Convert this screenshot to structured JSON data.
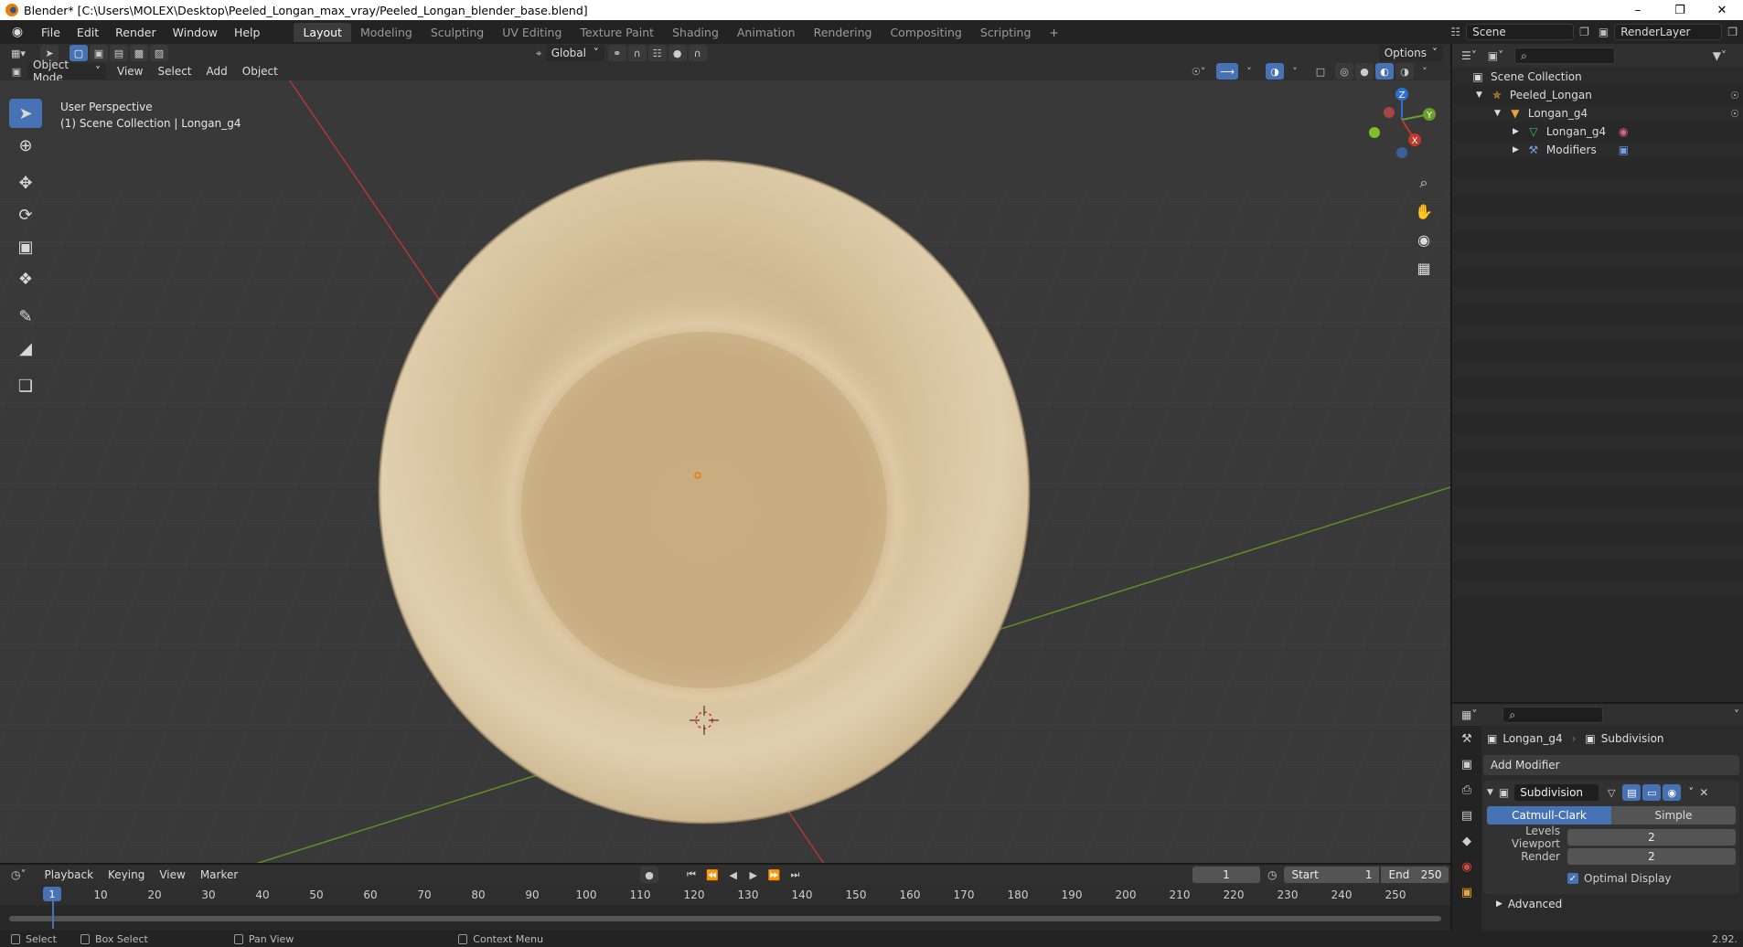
{
  "window": {
    "title": "Blender* [C:\\Users\\MOLEX\\Desktop\\Peeled_Longan_max_vray/Peeled_Longan_blender_base.blend]",
    "minimize": "–",
    "restore": "❐",
    "close": "✕"
  },
  "menu": [
    "File",
    "Edit",
    "Render",
    "Window",
    "Help"
  ],
  "workspaces": {
    "active": "Layout",
    "others": [
      "Modeling",
      "Sculpting",
      "UV Editing",
      "Texture Paint",
      "Shading",
      "Animation",
      "Rendering",
      "Compositing",
      "Scripting"
    ],
    "add": "+"
  },
  "scene": {
    "name": "Scene",
    "render_layer": "RenderLayer"
  },
  "viewport_header": {
    "mode": "Object Mode",
    "menus": [
      "View",
      "Select",
      "Add",
      "Object"
    ],
    "transform_orientation": "Global",
    "options": "Options"
  },
  "viewport": {
    "perspective": "User Perspective",
    "collection_info": "(1) Scene Collection | Longan_g4",
    "gizmo": {
      "z": "Z",
      "y": "Y",
      "x": "X"
    },
    "object_color": "#d8c7a3"
  },
  "outliner": {
    "root": "Scene Collection",
    "items": [
      {
        "label": "Peeled_Longan"
      },
      {
        "label": "Longan_g4"
      },
      {
        "label": "Longan_g4"
      },
      {
        "label": "Modifiers"
      }
    ]
  },
  "properties": {
    "object": "Longan_g4",
    "modifier": "Subdivision",
    "add_modifier": "Add Modifier",
    "modifier_name": "Subdivision",
    "methods": [
      "Catmull-Clark",
      "Simple"
    ],
    "levels_viewport_label": "Levels Viewport",
    "levels_viewport": "2",
    "render_label": "Render",
    "render": "2",
    "optimal_display": "Optimal Display",
    "advanced": "Advanced"
  },
  "timeline": {
    "menus": [
      "Playback",
      "Keying",
      "View",
      "Marker"
    ],
    "current_frame": "1",
    "start_label": "Start",
    "start": "1",
    "end_label": "End",
    "end": "250",
    "ruler": [
      "10",
      "20",
      "30",
      "40",
      "50",
      "60",
      "70",
      "80",
      "90",
      "100",
      "110",
      "120",
      "130",
      "140",
      "150",
      "160",
      "170",
      "180",
      "190",
      "200",
      "210",
      "220",
      "230",
      "240",
      "250"
    ],
    "playhead": "1"
  },
  "statusbar": {
    "select": "Select",
    "box_select": "Box Select",
    "pan_view": "Pan View",
    "context_menu": "Context Menu",
    "version": "2.92."
  },
  "colors": {
    "accent": "#4772b3",
    "x_axis": "#c0392b",
    "y_axis": "#6b9e2a",
    "z_axis": "#2f6fd0"
  }
}
